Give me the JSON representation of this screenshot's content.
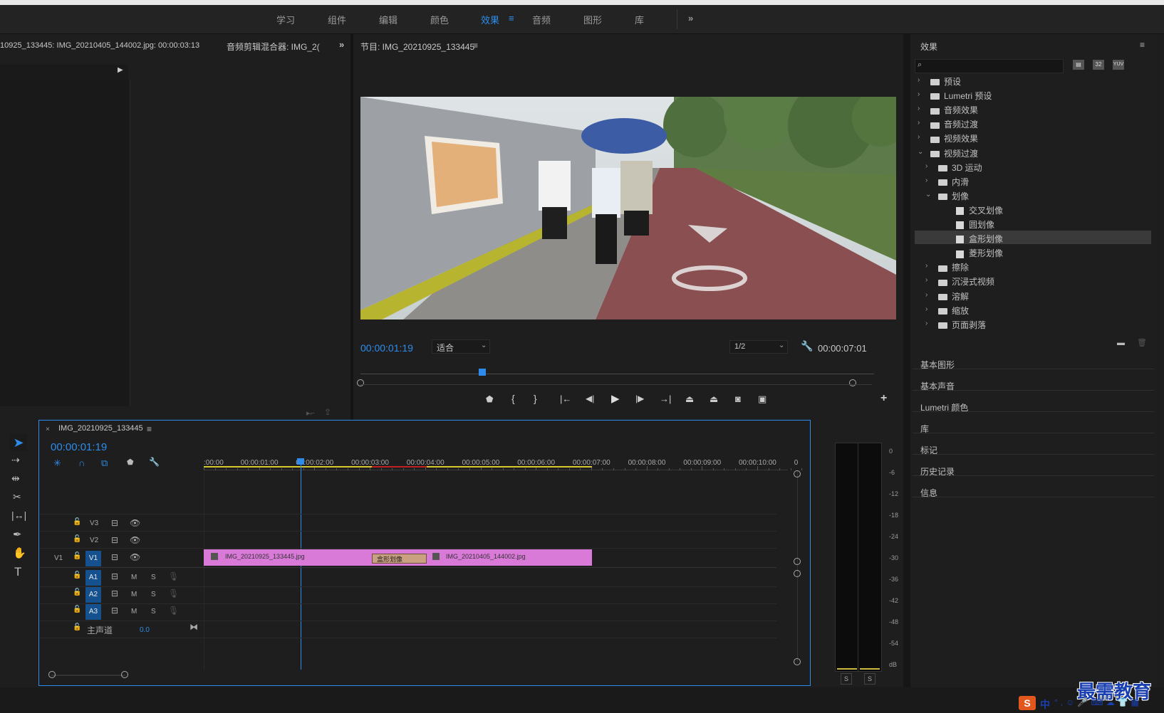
{
  "workspace_tabs": [
    "学习",
    "组件",
    "编辑",
    "颜色",
    "效果",
    "音频",
    "图形",
    "库"
  ],
  "active_tab_index": 4,
  "left_panel": {
    "title": "10925_133445: IMG_20210405_144002.jpg: 00:00:03:13",
    "tab2": "音频剪辑混合器: IMG_2("
  },
  "program": {
    "title": "节目: IMG_20210925_133445",
    "timecode": "00:00:01:19",
    "fit": "适合",
    "resolution": "1/2",
    "duration": "00:00:07:01"
  },
  "effects": {
    "title": "效果",
    "search_placeholder": "",
    "items": [
      {
        "label": "预设",
        "level": 0,
        "type": "folder-special",
        "chev": "›"
      },
      {
        "label": "Lumetri 预设",
        "level": 0,
        "type": "folder-special",
        "chev": "›"
      },
      {
        "label": "音频效果",
        "level": 0,
        "type": "folder",
        "chev": "›"
      },
      {
        "label": "音频过渡",
        "level": 0,
        "type": "folder",
        "chev": "›"
      },
      {
        "label": "视频效果",
        "level": 0,
        "type": "folder",
        "chev": "›"
      },
      {
        "label": "视频过渡",
        "level": 0,
        "type": "folder",
        "chev": "⌄"
      },
      {
        "label": "3D 运动",
        "level": 1,
        "type": "folder",
        "chev": "›"
      },
      {
        "label": "内滑",
        "level": 1,
        "type": "folder",
        "chev": "›"
      },
      {
        "label": "划像",
        "level": 1,
        "type": "folder",
        "chev": "⌄"
      },
      {
        "label": "交叉划像",
        "level": 2,
        "type": "fx",
        "chev": ""
      },
      {
        "label": "圆划像",
        "level": 2,
        "type": "fx",
        "chev": ""
      },
      {
        "label": "盒形划像",
        "level": 2,
        "type": "fx",
        "chev": "",
        "selected": true
      },
      {
        "label": "菱形划像",
        "level": 2,
        "type": "fx",
        "chev": ""
      },
      {
        "label": "擦除",
        "level": 1,
        "type": "folder",
        "chev": "›"
      },
      {
        "label": "沉浸式视频",
        "level": 1,
        "type": "folder",
        "chev": "›"
      },
      {
        "label": "溶解",
        "level": 1,
        "type": "folder",
        "chev": "›"
      },
      {
        "label": "缩放",
        "level": 1,
        "type": "folder",
        "chev": "›"
      },
      {
        "label": "页面剥落",
        "level": 1,
        "type": "folder",
        "chev": "›"
      }
    ]
  },
  "side_panels": [
    "基本图形",
    "基本声音",
    "Lumetri 颜色",
    "库",
    "标记",
    "历史记录",
    "信息"
  ],
  "timeline": {
    "sequence": "IMG_20210925_133445",
    "timecode": "00:00:01:19",
    "ruler": [
      ":00:00",
      "00:00:01:00",
      "00:00:02:00",
      "00:00:03:00",
      "00:00:04:00",
      "00:00:05:00",
      "00:00:06:00",
      "00:00:07:00",
      "00:00:08:00",
      "00:00:09:00",
      "00:00:10:00",
      "0"
    ],
    "video_tracks": [
      "V3",
      "V2",
      "V1"
    ],
    "audio_tracks": [
      "A1",
      "A2",
      "A3"
    ],
    "source_patch": "V1",
    "master_label": "主声道",
    "master_value": "0.0",
    "clip1": "IMG_20210925_133445.jpg",
    "transition": "盒形划像",
    "clip2": "IMG_20210405_144002.jpg",
    "m": "M",
    "s": "S"
  },
  "meter": {
    "scale": [
      "0",
      "-6",
      "-12",
      "-18",
      "-24",
      "-30",
      "-36",
      "-42",
      "-48",
      "-54",
      "dB"
    ],
    "solo": [
      "S",
      "S"
    ]
  },
  "watermark": "最需教育",
  "ime": "中"
}
